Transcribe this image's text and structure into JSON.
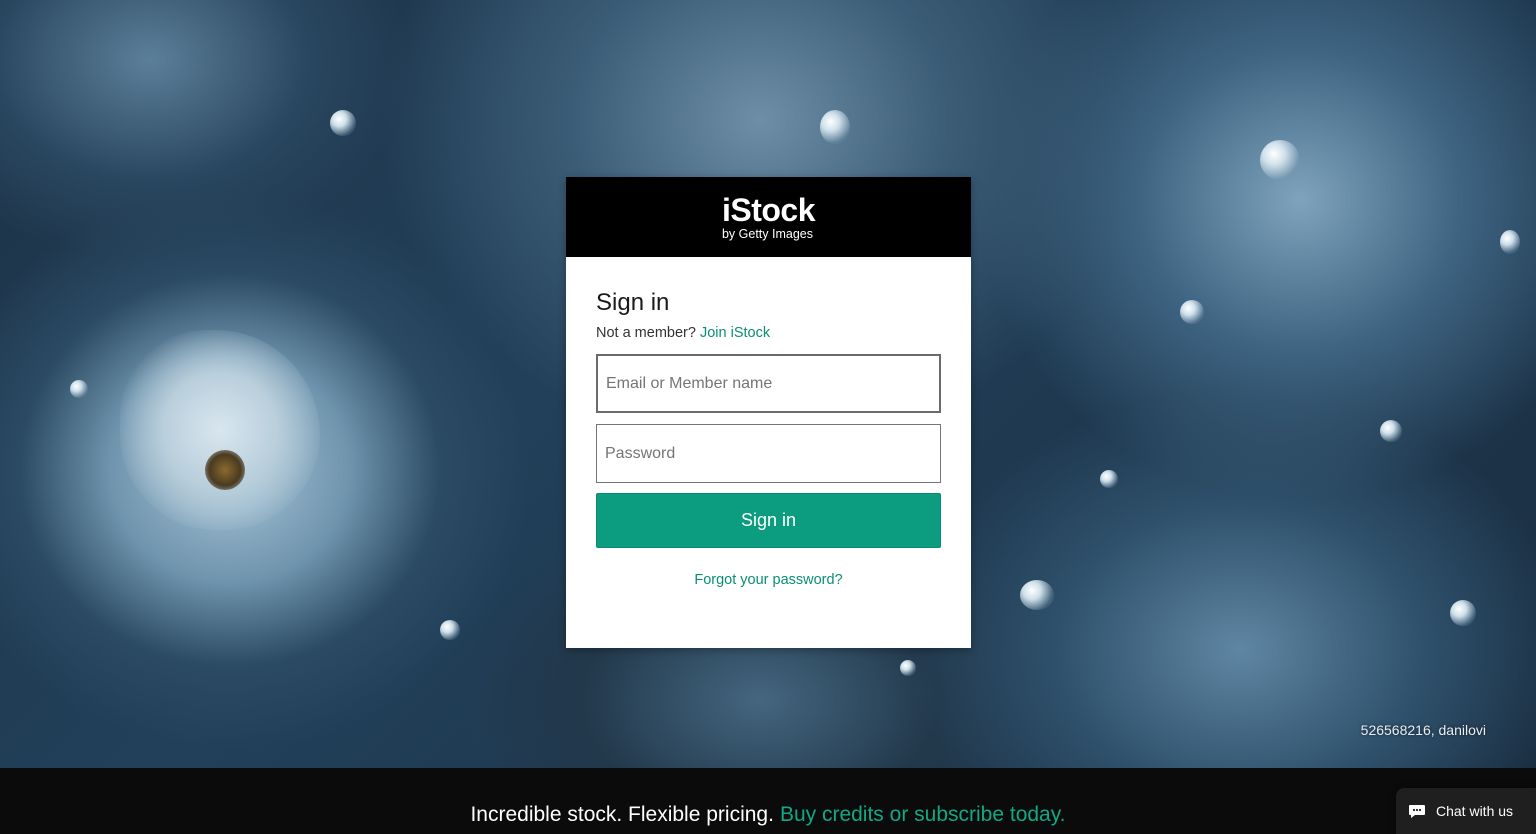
{
  "background": {
    "credit": "526568216, danilovi"
  },
  "logo": {
    "main": "iStock",
    "sub": "by Getty Images"
  },
  "signin": {
    "title": "Sign in",
    "member_prompt": "Not a member?",
    "join_link": "Join iStock",
    "email_placeholder": "Email or Member name",
    "email_value": "",
    "password_placeholder": "Password",
    "password_value": "",
    "button_label": "Sign in",
    "forgot_link": "Forgot your password?"
  },
  "banner": {
    "lead": "Incredible stock. Flexible pricing.",
    "cta": "Buy credits or subscribe today."
  },
  "chat": {
    "label": "Chat with us",
    "icon": "chat-bubble-icon"
  },
  "colors": {
    "accent": "#0c9c7f",
    "link": "#0b8f73",
    "header": "#000000",
    "banner": "#0b0b0b"
  }
}
